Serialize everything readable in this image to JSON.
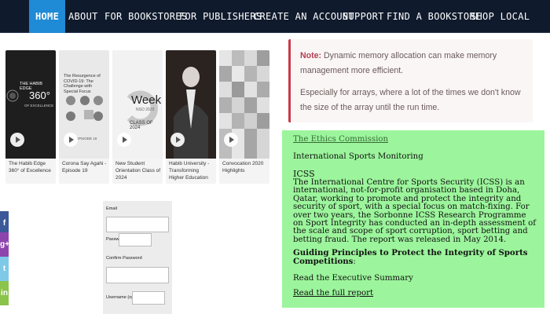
{
  "nav": {
    "items": [
      "HOME",
      "ABOUT",
      "FOR BOOKSTORES",
      "FOR PUBLISHERS",
      "CREATE AN ACCOUNT",
      "SUPPORT",
      "FIND A BOOKSTORE",
      "SHOP LOCAL"
    ],
    "active": "HOME"
  },
  "videos": [
    {
      "caption": "The Habib Edge 360° of Excellence",
      "thumb_title": "THE HABIB EDGE",
      "thumb_big": "360°",
      "thumb_sub": "OF EXCELLENCE"
    },
    {
      "caption": "Corona Say Agahi - Episode 19",
      "thumb_title": "The Resurgence of COVID-19: The Challenge with Special Focus",
      "thumb_badge": "EPISODE 19"
    },
    {
      "caption": "New Student Orientation Class of 2024",
      "thumb_big": "Week",
      "thumb_sub": "NSO 2020",
      "thumb_title": "CLASS OF 2024"
    },
    {
      "caption": "Habib University - Transforming Higher Education"
    },
    {
      "caption": "Convocation 2020 Highlights"
    }
  ],
  "note": {
    "label": "Note:",
    "text1": " Dynamic memory allocation can make memory management more efficient.",
    "text2": "Especially for arrays, where a lot of the times we don't know the size of the array until the run time."
  },
  "green": {
    "ethics_link": "The Ethics Commission",
    "sub_heading": "International Sports Monitoring",
    "icss_heading": "ICSS",
    "paragraph": "The International Centre for Sports Security (ICSS) is an international, not-for-profit organisation based in Doha, Qatar, working to promote and protect the integrity and security of sport, with a special focus on match-fixing. For over two years, the Sorbonne ICSS Research Programme on Sport Integrity has conducted an in-depth assessment of the scale and scope of sport corruption, sport betting and betting fraud. The report was released in May 2014.",
    "guiding": "Guiding Principles to Protect the Integrity of Sports Competitions",
    "guiding_suffix": ":",
    "exec_summary": "Read the Executive Summary",
    "full_report": "Read the full report"
  },
  "social": [
    {
      "icon": "facebook-icon",
      "glyph": "f",
      "color": "#3b5998"
    },
    {
      "icon": "google-plus-icon",
      "glyph": "g+",
      "color": "#8e44ad"
    },
    {
      "icon": "twitter-icon",
      "glyph": "t",
      "color": "#7ec9e8"
    },
    {
      "icon": "linkedin-icon",
      "glyph": "in",
      "color": "#8ac44a"
    }
  ],
  "form": {
    "email_label": "Email",
    "password_label": "Password",
    "confirm_label": "Confirm Password",
    "username_label": "Username (optional)"
  }
}
